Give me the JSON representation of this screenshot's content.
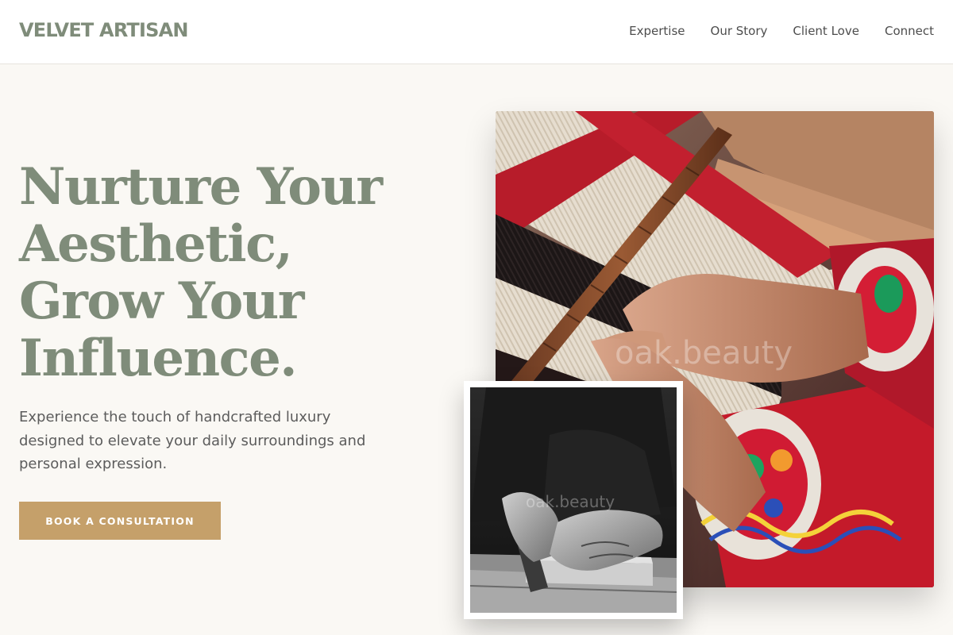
{
  "brand": {
    "name": "VELVET ARTISAN"
  },
  "nav": {
    "items": [
      {
        "label": "Expertise"
      },
      {
        "label": "Our Story"
      },
      {
        "label": "Client Love"
      },
      {
        "label": "Connect"
      }
    ]
  },
  "hero": {
    "headline_lines": [
      "Nurture Your",
      "Aesthetic,",
      "Grow Your",
      "Influence."
    ],
    "subtext": "Experience the touch of handcrafted luxury designed to elevate your daily surroundings and personal expression.",
    "cta_label": "BOOK A CONSULTATION"
  },
  "images": {
    "main_watermark": "oak.beauty",
    "secondary_watermark": "oak.beauty"
  },
  "colors": {
    "brand_sage": "#7f8c7a",
    "accent_gold": "#c5a06a",
    "background": "#faf8f4",
    "text_body": "#5c5c5c"
  }
}
